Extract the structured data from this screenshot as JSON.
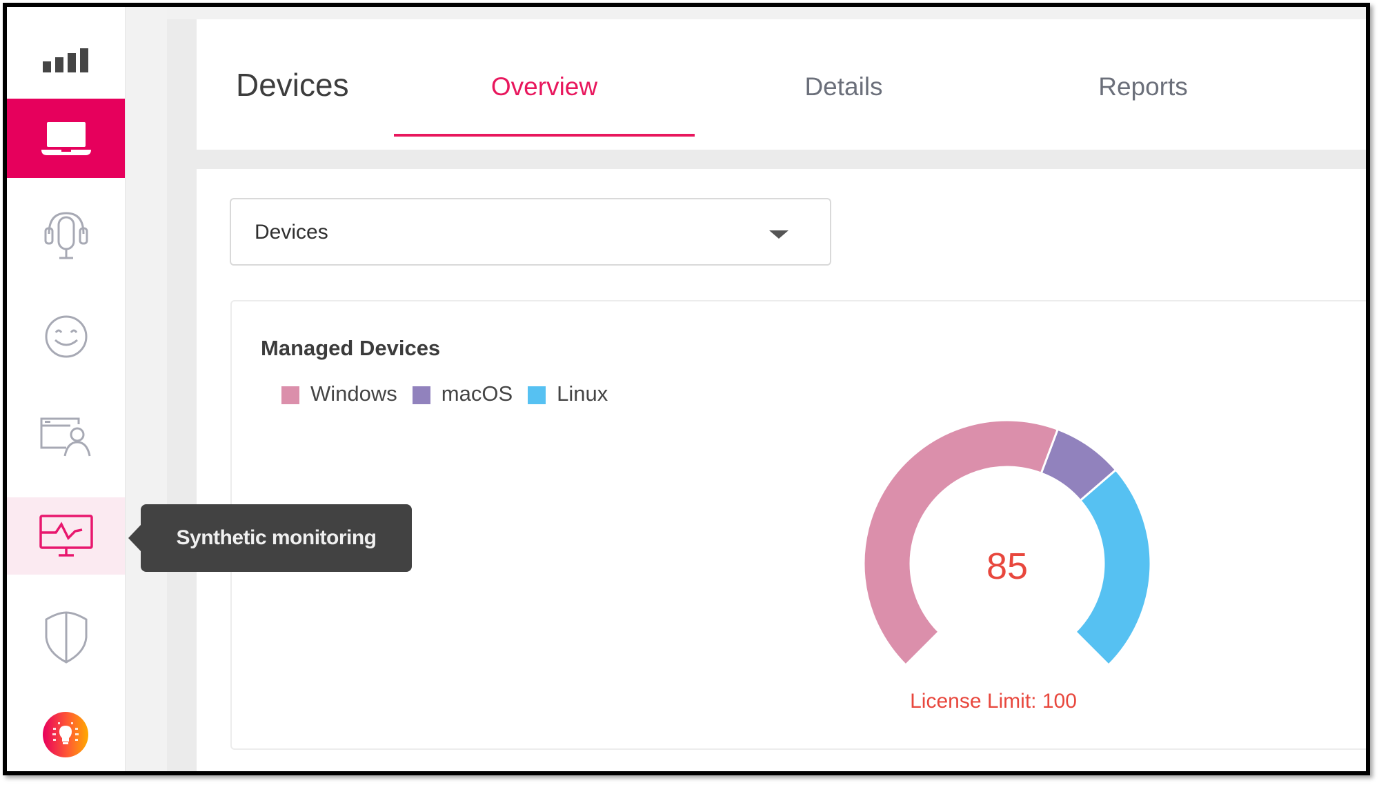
{
  "sidebar": {
    "items": [
      {
        "id": "signal",
        "icon": "signal-bars-icon",
        "active": false
      },
      {
        "id": "devices",
        "icon": "laptop-icon",
        "active": true
      },
      {
        "id": "support",
        "icon": "headset-icon",
        "active": false
      },
      {
        "id": "experience",
        "icon": "smiley-icon",
        "active": false
      },
      {
        "id": "users",
        "icon": "user-card-icon",
        "active": false
      },
      {
        "id": "synthetic-monitoring",
        "icon": "monitor-pulse-icon",
        "active": false,
        "hovered": true
      },
      {
        "id": "security",
        "icon": "shield-icon",
        "active": false
      },
      {
        "id": "insights",
        "icon": "lightbulb-icon",
        "active": false
      }
    ],
    "tooltip": "Synthetic monitoring"
  },
  "header": {
    "title": "Devices",
    "tabs": [
      {
        "label": "Overview",
        "active": true
      },
      {
        "label": "Details",
        "active": false
      },
      {
        "label": "Reports",
        "active": false
      }
    ]
  },
  "filter": {
    "selected": "Devices"
  },
  "card": {
    "title": "Managed Devices"
  },
  "colors": {
    "accent": "#e6005c",
    "windows": "#db8fab",
    "macos": "#9182bd",
    "linux": "#56c1f2",
    "gauge_text": "#e8473d"
  },
  "chart_data": {
    "type": "pie",
    "subtype": "gauge-donut",
    "title": "Managed Devices",
    "legend": [
      "Windows",
      "macOS",
      "Linux"
    ],
    "legend_position": "top-left",
    "categories": [
      "Windows",
      "macOS",
      "Linux"
    ],
    "values": [
      49,
      9,
      27
    ],
    "total": 85,
    "center_label": "85",
    "caption": "License Limit: 100",
    "license_limit": 100
  }
}
